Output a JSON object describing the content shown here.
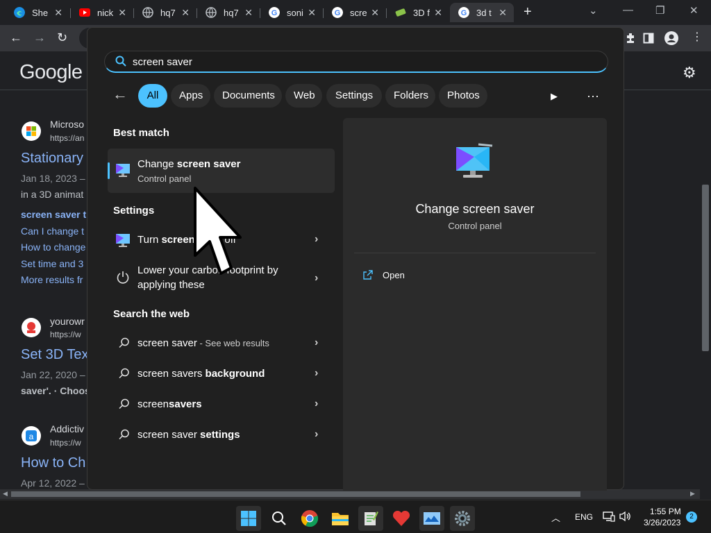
{
  "browser": {
    "tabs": [
      {
        "title": "Shel",
        "icon": "edge-logo-icon",
        "color": "#1a8fe3"
      },
      {
        "title": "nick",
        "icon": "youtube-icon",
        "color": "#ff0000"
      },
      {
        "title": "hq7",
        "icon": "globe-icon",
        "color": "#9aa0a6"
      },
      {
        "title": "hq7",
        "icon": "globe-icon",
        "color": "#9aa0a6"
      },
      {
        "title": "soni",
        "icon": "google-g-icon",
        "color": "#ffffff"
      },
      {
        "title": "scre",
        "icon": "google-g-icon",
        "color": "#ffffff"
      },
      {
        "title": "3D f",
        "icon": "site-icon",
        "color": "#8bc34a"
      },
      {
        "title": "3d t",
        "icon": "google-g-icon",
        "color": "#ffffff"
      }
    ],
    "new_tab": "+",
    "window_controls": {
      "tab_search": "⌄",
      "minimize": "—",
      "restore": "❐",
      "close": "✕"
    },
    "nav": {
      "back": "←",
      "forward": "→",
      "reload": "↻"
    }
  },
  "google": {
    "logo": "Google",
    "results": [
      {
        "site": "Microso",
        "url": "https://an",
        "title": "Stationary",
        "date": "Jan 18, 2023 –",
        "snippet": "in a 3D animat",
        "links": [
          "screen saver t",
          "Can I change t",
          "How to change",
          "Set time and 3",
          "More results fr"
        ]
      },
      {
        "site": "yourowr",
        "url": "https://w",
        "title": "Set 3D Tex",
        "date": "Jan 22, 2020 –",
        "snippet": "saver'. · Choos"
      },
      {
        "site": "Addictiv",
        "url": "https://w",
        "title": "How to Ch",
        "date": "Apr 12, 2022 –"
      }
    ]
  },
  "search": {
    "query": "screen saver",
    "filters": [
      "All",
      "Apps",
      "Documents",
      "Web",
      "Settings",
      "Folders",
      "Photos"
    ],
    "more": "···",
    "play": "▶",
    "best_match_heading": "Best match",
    "best_match": {
      "title_plain": "Change ",
      "title_bold": "screen saver",
      "subtitle": "Control panel"
    },
    "settings_heading": "Settings",
    "settings_items": [
      {
        "line1_plain": "Turn ",
        "line1_bold": "screen",
        "line1_rest": " on or off"
      },
      {
        "line1": "Lower your carbon footprint by",
        "line2": "applying these"
      }
    ],
    "web_heading": "Search the web",
    "web_items": [
      {
        "main": "screen saver",
        "suffix": " - See web results",
        "bold": ""
      },
      {
        "main": "screen savers ",
        "bold": "background",
        "suffix": ""
      },
      {
        "main": "screen",
        "bold": "savers",
        "suffix": ""
      },
      {
        "main": "screen saver ",
        "bold": "settings",
        "suffix": ""
      }
    ],
    "preview": {
      "title": "Change screen saver",
      "subtitle": "Control panel",
      "action": "Open"
    }
  },
  "taskbar": {
    "apps": [
      "windows-start-icon",
      "search-icon",
      "chrome-icon",
      "file-explorer-icon",
      "notepad-icon",
      "heart-app-icon",
      "photos-icon",
      "settings-icon"
    ],
    "language": "ENG",
    "time": "1:55 PM",
    "date": "3/26/2023",
    "notifications": "2"
  },
  "colors": {
    "accent": "#4cc2ff",
    "flyout_bg": "#202020",
    "link": "#8ab4f8"
  }
}
